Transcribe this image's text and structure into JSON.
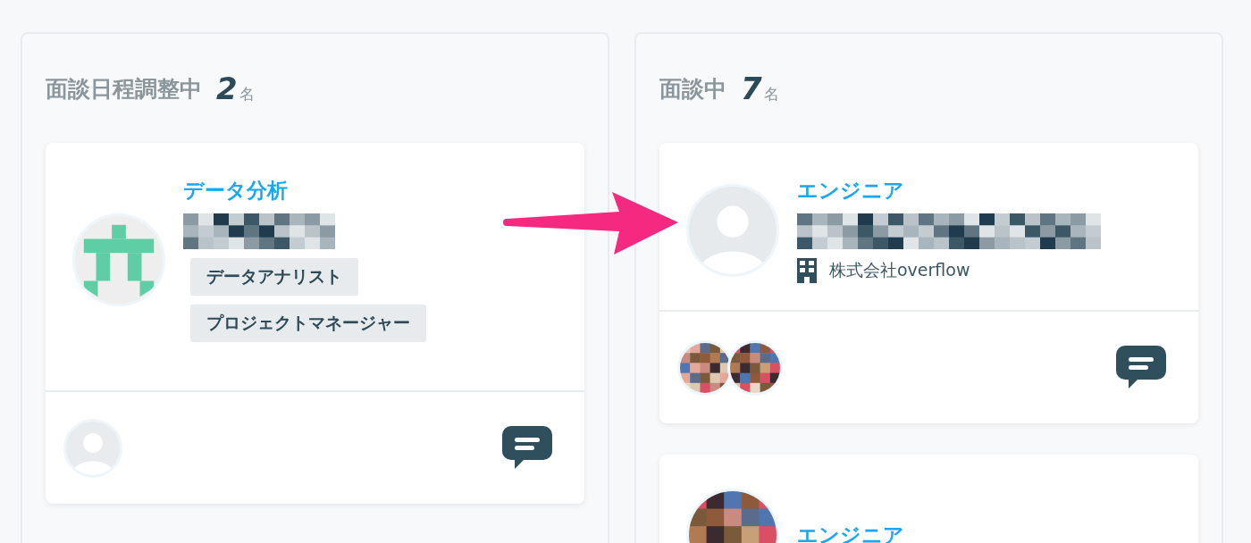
{
  "columns": [
    {
      "title": "面談日程調整中",
      "count": "2",
      "unit": "名",
      "cards": [
        {
          "avatar": {
            "kind": "logo"
          },
          "category": "データ分析",
          "name_redacted": true,
          "tags": [
            "データアナリスト",
            "プロジェクトマネージャー"
          ],
          "members": [
            {
              "kind": "placeholder"
            }
          ]
        }
      ]
    },
    {
      "title": "面談中",
      "count": "7",
      "unit": "名",
      "cards": [
        {
          "avatar": {
            "kind": "default"
          },
          "category": "エンジニア",
          "name_redacted": true,
          "company": "株式会社overflow"
        },
        {
          "category": "エンジニア"
        }
      ]
    }
  ],
  "arrow": true
}
